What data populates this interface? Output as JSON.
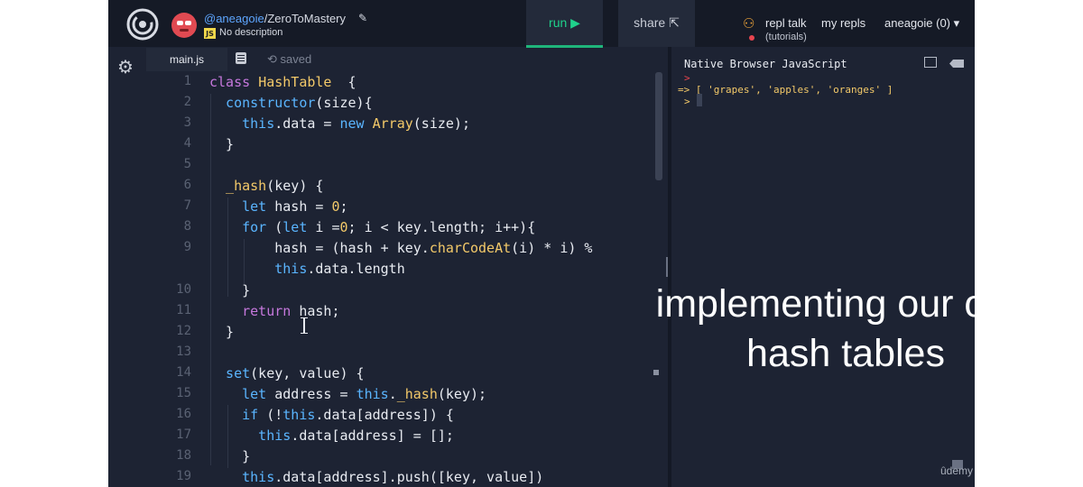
{
  "topbar": {
    "handle": "@aneagoie",
    "repl_name": "/ZeroToMastery",
    "language_badge": "JS",
    "description": "No description",
    "run_label": "run ▶",
    "share_label": "share",
    "repl_talk_label": "repl talk",
    "repl_talk_sub": "(tutorials)",
    "my_repls_label": "my repls",
    "user_menu_label": "aneagoie (0) ▾"
  },
  "editor": {
    "file_tab": "main.js",
    "status": "saved",
    "line_numbers": [
      "1",
      "2",
      "3",
      "4",
      "5",
      "6",
      "7",
      "8",
      "9",
      "10",
      "11",
      "12",
      "13",
      "14",
      "15",
      "16",
      "17",
      "18",
      "19"
    ],
    "lines": [
      [
        [
          "kw",
          "class "
        ],
        [
          "fn",
          "HashTable"
        ],
        [
          "",
          "  {"
        ]
      ],
      [
        [
          "kb",
          "  constructor"
        ],
        [
          "",
          "(size){"
        ]
      ],
      [
        [
          "kb",
          "    this"
        ],
        [
          "",
          ".data = "
        ],
        [
          "kb",
          "new "
        ],
        [
          "fn",
          "Array"
        ],
        [
          "",
          "(size);"
        ]
      ],
      [
        [
          "",
          "  }"
        ]
      ],
      [
        [
          "",
          ""
        ]
      ],
      [
        [
          "fn",
          "  _hash"
        ],
        [
          "",
          "(key) {"
        ]
      ],
      [
        [
          "kb",
          "    let "
        ],
        [
          "",
          "hash = "
        ],
        [
          "num",
          "0"
        ],
        [
          "",
          ";"
        ]
      ],
      [
        [
          "kb",
          "    for "
        ],
        [
          "",
          "("
        ],
        [
          "kb",
          "let "
        ],
        [
          "",
          "i ="
        ],
        [
          "num",
          "0"
        ],
        [
          "",
          "; i < key.length; i++){"
        ]
      ],
      [
        [
          "",
          "        hash = (hash + key."
        ],
        [
          "fn",
          "charCodeAt"
        ],
        [
          "",
          "(i) * i) %"
        ]
      ],
      [
        [
          "kb",
          "        this"
        ],
        [
          "",
          ".data.length"
        ]
      ],
      [
        [
          "",
          "    }"
        ]
      ],
      [
        [
          "kw",
          "    return "
        ],
        [
          "",
          "hash;"
        ]
      ],
      [
        [
          "",
          "  }"
        ]
      ],
      [
        [
          "",
          ""
        ]
      ],
      [
        [
          "kb",
          "  set"
        ],
        [
          "",
          "(key, value) {"
        ]
      ],
      [
        [
          "kb",
          "    let "
        ],
        [
          "",
          "address = "
        ],
        [
          "kb",
          "this"
        ],
        [
          "",
          "."
        ],
        [
          "fn",
          "_hash"
        ],
        [
          "",
          "(key);"
        ]
      ],
      [
        [
          "kb",
          "    if "
        ],
        [
          "",
          "(!"
        ],
        [
          "kb",
          "this"
        ],
        [
          "",
          ".data[address]) {"
        ]
      ],
      [
        [
          "kb",
          "      this"
        ],
        [
          "",
          ".data[address] = [];"
        ]
      ],
      [
        [
          "",
          "    }"
        ]
      ],
      [
        [
          "kb",
          "    this"
        ],
        [
          "",
          ".data[address].push([key, value])"
        ]
      ]
    ]
  },
  "console": {
    "title": "Native Browser JavaScript",
    "prompt_1": ">",
    "result_line": "=> [ 'grapes', 'apples', 'oranges' ]",
    "prompt_2": ">"
  },
  "overlay": {
    "caption_line_1": "implementing our own",
    "caption_line_2": "hash tables",
    "watermark": "ûdemy"
  },
  "colors": {
    "editor_bg": "#1d2333",
    "topbar_bg": "#151a26",
    "run_accent": "#1fd18b",
    "keyword": "#c678dd",
    "builtin": "#5ab5ff",
    "function": "#f3c969"
  }
}
